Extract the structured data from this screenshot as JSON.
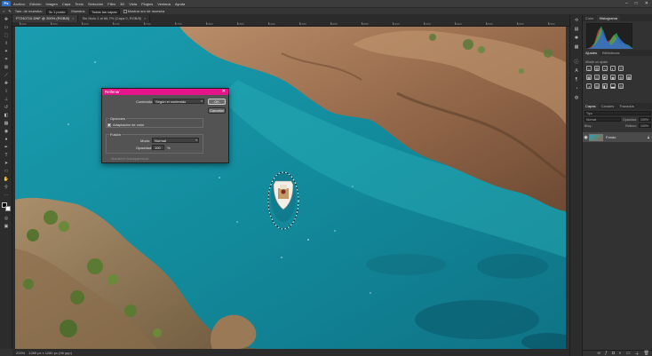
{
  "menubar": {
    "app_logo": "Ps",
    "items": [
      "Archivo",
      "Edición",
      "Imagen",
      "Capa",
      "Texto",
      "Selección",
      "Filtro",
      "3D",
      "Vista",
      "Plugins",
      "Ventana",
      "Ayuda"
    ],
    "window_controls": [
      "–",
      "□",
      "✕"
    ]
  },
  "options_bar": {
    "tamano_label": "Tam. de muestra:",
    "tamano_value": "3x 1 punto",
    "muestra_label": "Muestra:",
    "muestra_value": "Todas las capas",
    "show_ring_label": "Mostrar aro de muestra"
  },
  "tabs": [
    {
      "label": "P7240710-DNF @ 200% (RGB/8)",
      "active": true
    },
    {
      "label": "Sin título-1 al 66,7% (Capa 0, RGB/8)",
      "active": false
    }
  ],
  "ruler_top_labels": [
    "1500",
    "1550",
    "1600",
    "1650",
    "1700",
    "1750",
    "1800",
    "1850",
    "1900",
    "1950",
    "2000",
    "2050",
    "2100",
    "2150",
    "2200",
    "2250",
    "2300",
    "2350"
  ],
  "status": {
    "zoom": "200%",
    "doc": "1280 px x 1280 px (96 ppp)"
  },
  "panels": {
    "top_tabs": [
      "Color",
      "Histograma"
    ],
    "adj_tabs": [
      "Ajustes",
      "Bibliotecas"
    ],
    "adj_subtitle": "Añadir un ajuste",
    "layers_tabs": [
      "Capas",
      "Canales",
      "Trazados"
    ],
    "layer_filter_label": "Tipo",
    "blend_mode": "Normal",
    "opacity_label": "Opacidad:",
    "opacity_value": "100%",
    "lock_label": "Bloq.:",
    "fill_label": "Relleno:",
    "fill_value": "100%",
    "layer_name": "Fondo"
  },
  "dialog": {
    "title": "Rellenar",
    "contenido_label": "Contenido:",
    "contenido_value": "Según el contenido",
    "ok": "OK",
    "cancel": "Cancelar",
    "opciones_label": "Opciones",
    "adaptacion_label": "Adaptación de color",
    "adaptacion_checked": true,
    "fusion_label": "Fusión",
    "modo_label": "Modo:",
    "modo_value": "Normal",
    "opacidad_label": "Opacidad:",
    "opacidad_value": "100",
    "opacidad_unit": "%",
    "preserve_label": "Mantener transparencia"
  },
  "colors": {
    "dialog_title_bar": "#e6148a",
    "water": "#1a8fa0",
    "rock": "#8f6a4a"
  }
}
